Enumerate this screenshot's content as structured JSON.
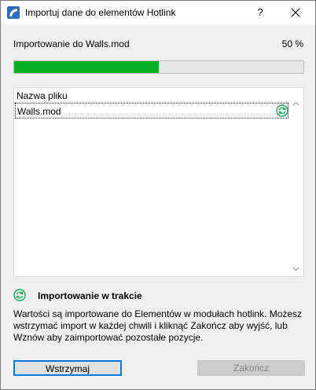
{
  "window": {
    "title": "Importuj dane do elementów Hotlink",
    "help_label": "?"
  },
  "progress": {
    "label": "Importowanie do Walls.mod",
    "percent_text": "50 %",
    "fraction": 0.5,
    "fill_color": "#06b025"
  },
  "file_list": {
    "column_header": "Nazwa pliku",
    "rows": [
      {
        "name": "Walls.mod",
        "status_icon": "importing-icon"
      }
    ]
  },
  "status": {
    "icon": "importing-icon",
    "text": "Importowanie w trakcie",
    "icon_color": "#1aa553"
  },
  "description": "Wartości są importowane do Elementów w modułach hotlink. Możesz wstrzymać import w każdej chwili i kliknąć Zakończ aby wyjść, lub Wznów aby zaimportować pozostałe pozycje.",
  "buttons": {
    "pause_label": "Wstrzymaj",
    "finish_label": "Zakończ"
  }
}
